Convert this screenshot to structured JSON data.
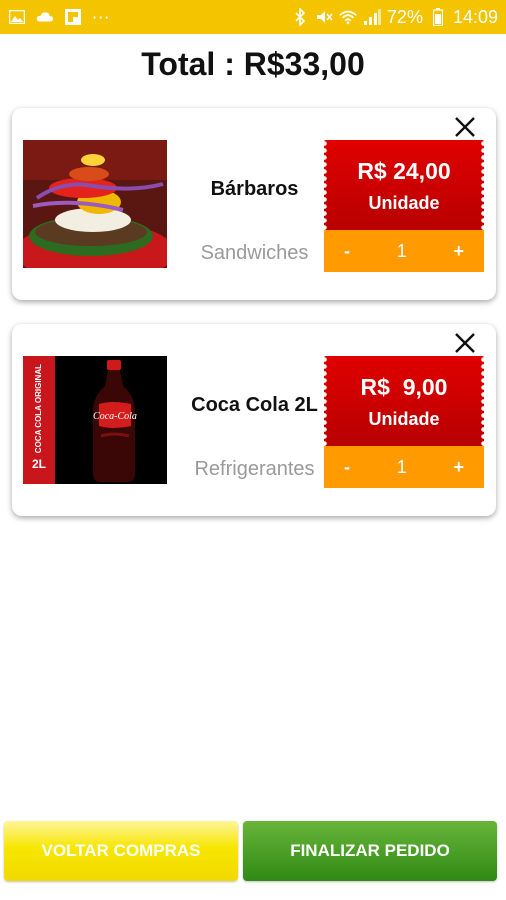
{
  "status_bar": {
    "icons_left": [
      "gallery-icon",
      "cloud-icon",
      "flipboard-icon"
    ],
    "more": "···",
    "icons_right": [
      "bluetooth-icon",
      "mute-icon",
      "wifi-icon",
      "signal-icon"
    ],
    "battery": "72%",
    "time": "14:09"
  },
  "cart": {
    "total": "Total : R$33,00",
    "items": [
      {
        "name": "Bárbaros",
        "category": "Sandwiches",
        "price": "R$ 24,00",
        "unit": "Unidade",
        "minus": "-",
        "quantity": "1",
        "plus": "+"
      },
      {
        "name": "Coca Cola 2L",
        "category": "Refrigerantes",
        "price": "R$  9,00",
        "unit": "Unidade",
        "minus": "-",
        "quantity": "1",
        "plus": "+",
        "label_side": "COCA COLA ORIGINAL",
        "label_size": "2L",
        "label_brand": "Coca-Cola"
      }
    ]
  },
  "actions": {
    "back": "VOLTAR COMPRAS",
    "finish": "FINALIZAR PEDIDO"
  },
  "colors": {
    "status_bar": "#f5c400",
    "price_red": "#d40000",
    "qty_orange": "#ff9a00",
    "finish_green": "#3a9a1e",
    "back_yellow": "#f3dc00"
  }
}
